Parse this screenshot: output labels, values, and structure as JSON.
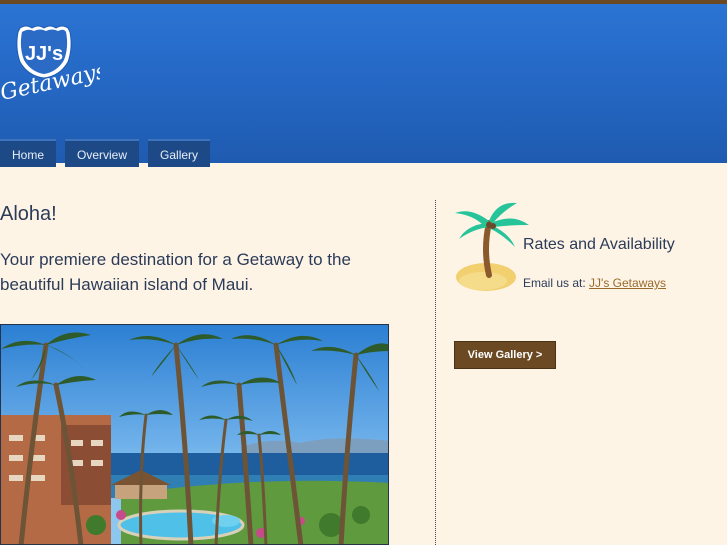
{
  "logo": {
    "badge_text": "JJ's",
    "script_text": "Getaways"
  },
  "nav": {
    "items": [
      {
        "label": "Home"
      },
      {
        "label": "Overview"
      },
      {
        "label": "Gallery"
      }
    ]
  },
  "main": {
    "greeting": "Aloha!",
    "intro": "Your premiere destination for a Getaway to the beautiful Hawaiian island of Maui."
  },
  "sidebar": {
    "rates_title": "Rates and Availability",
    "email_prefix": "Email us at:",
    "email_link": "JJ's Getaways",
    "gallery_button": "View Gallery >"
  },
  "colors": {
    "header_blue": "#2466c2",
    "nav_bg": "#1d4a86",
    "page_bg": "#fdf4e6",
    "accent_brown": "#6b4a23",
    "text": "#2c3b58",
    "link": "#9a6a2a"
  }
}
